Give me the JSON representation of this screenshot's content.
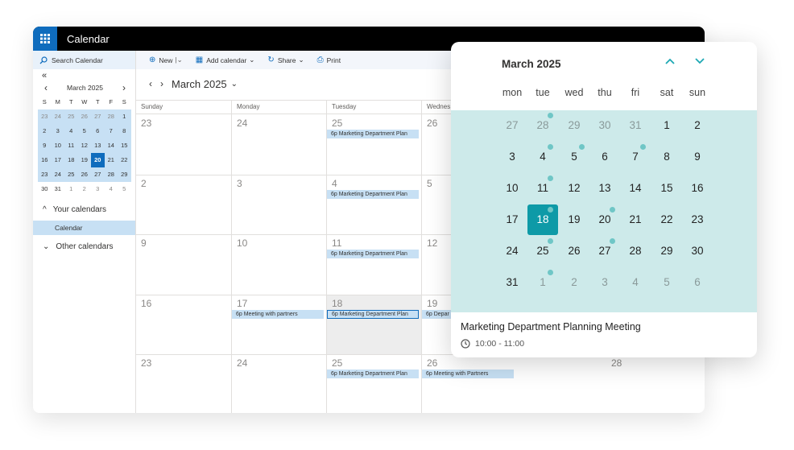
{
  "app": {
    "title": "Calendar"
  },
  "sidebar": {
    "search_placeholder": "Search Calendar",
    "collapse_icon": "«",
    "mini": {
      "month": "March 2025",
      "dow": [
        "S",
        "M",
        "T",
        "W",
        "T",
        "F",
        "S"
      ],
      "weeks": [
        [
          "23",
          "24",
          "25",
          "26",
          "27",
          "28",
          "1"
        ],
        [
          "2",
          "3",
          "4",
          "5",
          "6",
          "7",
          "8"
        ],
        [
          "9",
          "10",
          "11",
          "12",
          "13",
          "14",
          "15"
        ],
        [
          "16",
          "17",
          "18",
          "19",
          "20",
          "21",
          "22"
        ],
        [
          "23",
          "24",
          "25",
          "26",
          "27",
          "28",
          "29"
        ],
        [
          "30",
          "31",
          "1",
          "2",
          "3",
          "4",
          "5"
        ]
      ],
      "today": "20"
    },
    "your_calendars": "Your calendars",
    "calendar_item": "Calendar",
    "other_calendars": "Other calendars"
  },
  "toolbar": {
    "new_label": "New",
    "add_calendar_label": "Add calendar",
    "share_label": "Share",
    "print_label": "Print"
  },
  "nav": {
    "month": "March 2025"
  },
  "grid": {
    "dow": [
      "Sunday",
      "Monday",
      "Tuesday",
      "Wednes"
    ],
    "weeks": [
      [
        "23",
        "24",
        "25",
        "26"
      ],
      [
        "2",
        "3",
        "4",
        "5"
      ],
      [
        "9",
        "10",
        "11",
        "12"
      ],
      [
        "16",
        "17",
        "18",
        "19"
      ],
      [
        "23",
        "24",
        "25",
        "26"
      ]
    ],
    "week5_saturday": "28",
    "events": {
      "e1": "6p Marketing Department Plan",
      "e2": "6p Marketing Department Plan",
      "e3": "6p Marketing Department Plan",
      "e4": "6p Meeting with partners",
      "e5": "6p Marketing Department Plan",
      "e6": "6p Depar",
      "e7": "6p Marketing Department Plan",
      "e8": "6p Meeting with Partners"
    }
  },
  "popup": {
    "month": "March 2025",
    "dow": [
      "mon",
      "tue",
      "wed",
      "thu",
      "fri",
      "sat",
      "sun"
    ],
    "weeks": [
      [
        "27",
        "28",
        "29",
        "30",
        "31",
        "1",
        "2"
      ],
      [
        "3",
        "4",
        "5",
        "6",
        "7",
        "8",
        "9"
      ],
      [
        "10",
        "11",
        "12",
        "13",
        "14",
        "15",
        "16"
      ],
      [
        "17",
        "18",
        "19",
        "20",
        "21",
        "22",
        "23"
      ],
      [
        "24",
        "25",
        "26",
        "27",
        "28",
        "29",
        "30"
      ],
      [
        "31",
        "1",
        "2",
        "3",
        "4",
        "5",
        "6"
      ]
    ],
    "selected": "18",
    "event_title": "Marketing Department Planning Meeting",
    "event_time": "10:00 - 11:00",
    "accent": "#0e9aa7"
  }
}
